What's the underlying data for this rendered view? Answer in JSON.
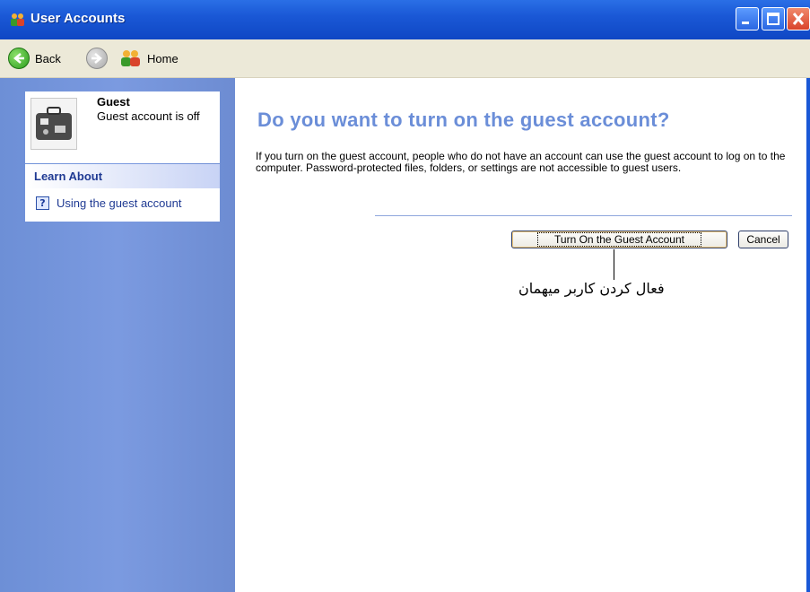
{
  "window": {
    "title": "User Accounts",
    "controls": [
      "minimize",
      "maximize",
      "close"
    ]
  },
  "nav": {
    "back_label": "Back",
    "home_label": "Home"
  },
  "sidebar": {
    "account": {
      "name": "Guest",
      "status": "Guest account is off"
    },
    "learn_about": {
      "heading": "Learn About",
      "links": [
        {
          "label": "Using the guest account",
          "icon": "help-icon"
        }
      ]
    }
  },
  "main": {
    "heading": "Do you want to turn on the guest account?",
    "description": "If you turn on the guest account, people who do not have an account can use the guest account to log on to the computer. Password-protected files, folders, or settings are not accessible to guest users.",
    "primary_button": "Turn On the Guest Account",
    "cancel_button": "Cancel",
    "annotation": "فعال کردن کاربر میهمان"
  },
  "colors": {
    "titlebar": "#1a58d6",
    "sidebar": "#7b9ae0",
    "heading": "#6b8ed8",
    "link": "#1f3a93"
  }
}
